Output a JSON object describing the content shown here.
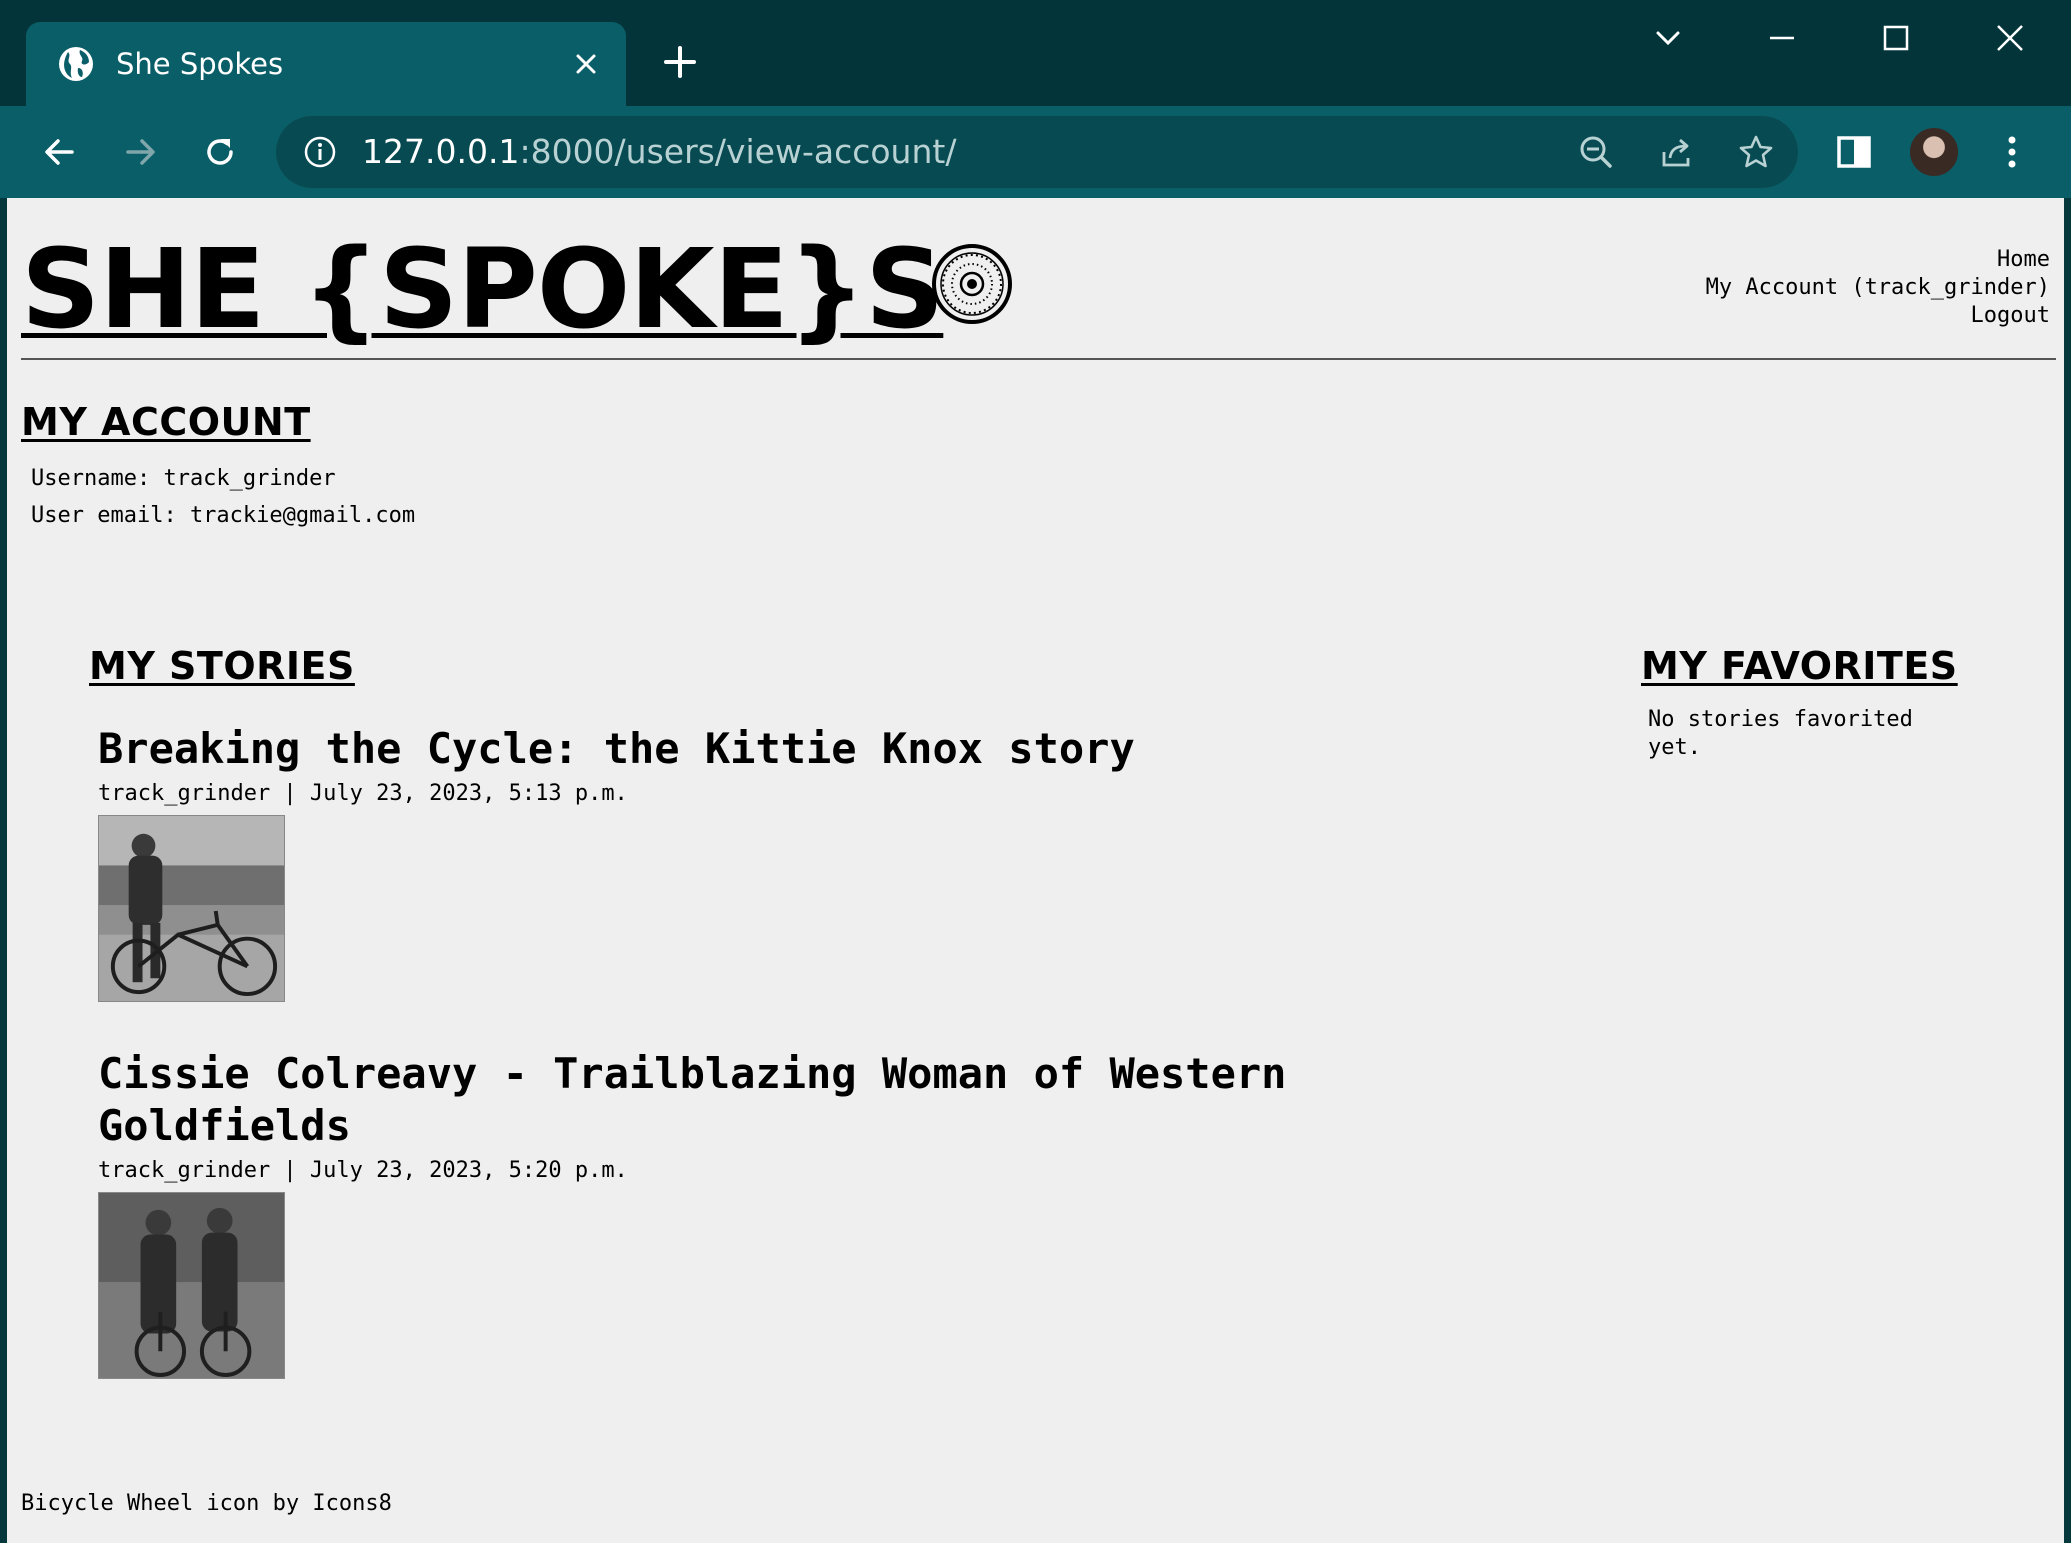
{
  "browser": {
    "tab_title": "She Spokes",
    "url_host": "127.0.0.1",
    "url_path": ":8000/users/view-account/"
  },
  "site": {
    "title": "SHE {SPOKE}S",
    "nav": {
      "home": "Home",
      "account": "My Account (track_grinder)",
      "logout": "Logout"
    }
  },
  "account": {
    "heading": "MY ACCOUNT",
    "username_line": "Username: track_grinder",
    "email_line": "User email: trackie@gmail.com"
  },
  "stories": {
    "heading": "MY STORIES",
    "items": [
      {
        "title": "Breaking the Cycle: the Kittie Knox story",
        "meta": "track_grinder | July 23, 2023, 5:13 p.m."
      },
      {
        "title": "Cissie Colreavy - Trailblazing Woman of Western Goldfields",
        "meta": "track_grinder | July 23, 2023, 5:20 p.m."
      }
    ]
  },
  "favorites": {
    "heading": "MY FAVORITES",
    "empty_text": "No stories favorited yet."
  },
  "footer": {
    "credit": "Bicycle Wheel icon by Icons8"
  },
  "colors": {
    "tab_active": "#0a5e67",
    "tabstrip": "#03343a",
    "page_bg": "#efefef"
  }
}
